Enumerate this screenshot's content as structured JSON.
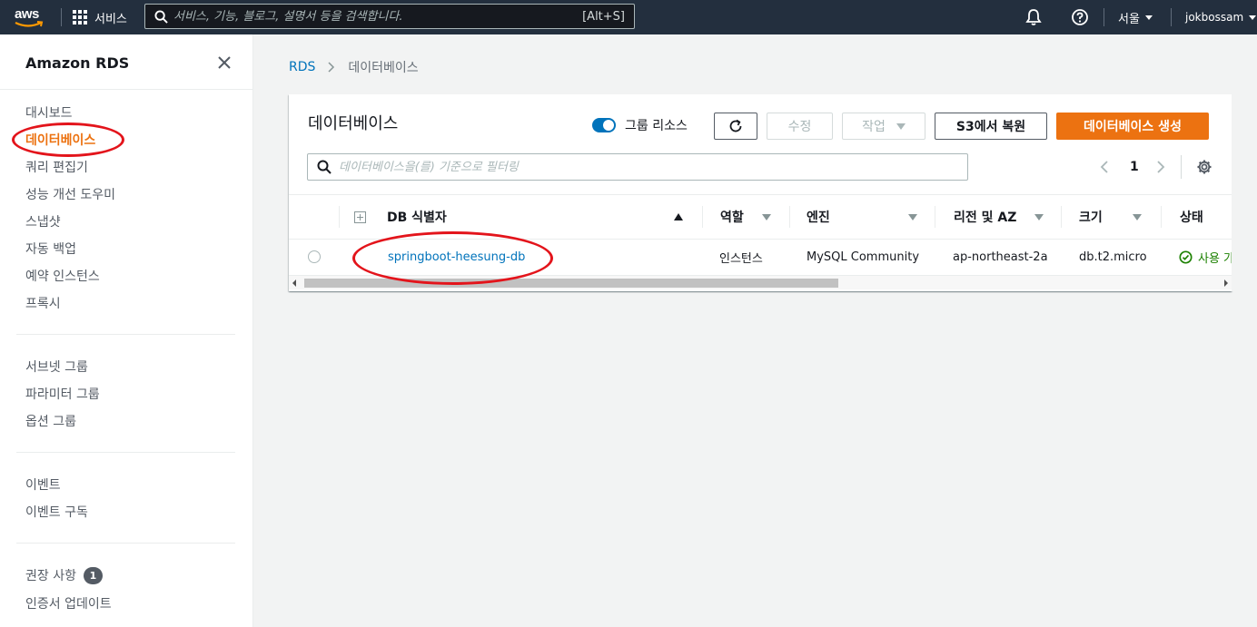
{
  "topnav": {
    "logo": "aws",
    "services_label": "서비스",
    "search_placeholder": "서비스, 기능, 블로그, 설명서 등을 검색합니다.",
    "search_hint": "[Alt+S]",
    "region": "서울",
    "user": "jokbossam",
    "icons": [
      "grid-icon",
      "search-icon",
      "bell-icon",
      "help-icon",
      "caret-down-icon"
    ]
  },
  "sidebar": {
    "title": "Amazon RDS",
    "groups": [
      [
        "대시보드",
        "데이터베이스",
        "쿼리 편집기",
        "성능 개선 도우미",
        "스냅샷",
        "자동 백업",
        "예약 인스턴스",
        "프록시"
      ],
      [
        "서브넷 그룹",
        "파라미터 그룹",
        "옵션 그룹"
      ],
      [
        "이벤트",
        "이벤트 구독"
      ],
      [
        "권장 사항",
        "인증서 업데이트"
      ]
    ],
    "active_item": "데이터베이스",
    "recommendations_badge": "1"
  },
  "breadcrumb": {
    "root": "RDS",
    "current": "데이터베이스"
  },
  "panel": {
    "title": "데이터베이스",
    "group_resources_label": "그룹 리소스",
    "group_resources_on": true,
    "buttons": {
      "modify": "수정",
      "actions": "작업",
      "restore_s3": "S3에서 복원",
      "create": "데이터베이스 생성"
    },
    "filter_placeholder": "데이터베이스을(를) 기준으로 필터링",
    "page": "1"
  },
  "table": {
    "columns": [
      "DB 식별자",
      "역할",
      "엔진",
      "리전 및 AZ",
      "크기",
      "상태"
    ],
    "rows": [
      {
        "identifier": "springboot-heesung-db",
        "role": "인스턴스",
        "engine": "MySQL Community",
        "region_az": "ap-northeast-2a",
        "size": "db.t2.micro",
        "status": "사용 가능"
      }
    ]
  },
  "colors": {
    "nav_bg": "#232f3e",
    "accent": "#ec7211",
    "link": "#0073bb",
    "success": "#1d8102",
    "annotation": "#e3141b"
  }
}
